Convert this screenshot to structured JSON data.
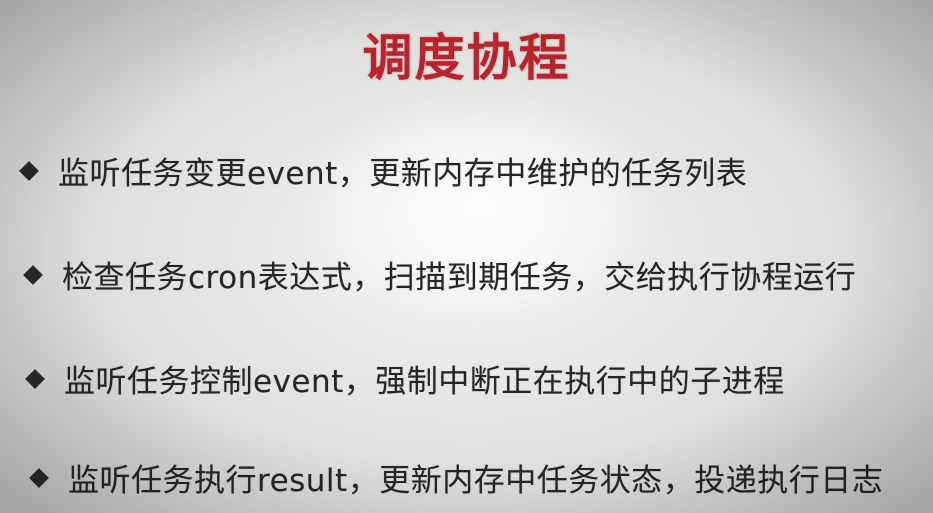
{
  "slide": {
    "title": "调度协程",
    "title_color": "#b8242b",
    "bullets": [
      "监听任务变更event，更新内存中维护的任务列表",
      "检查任务cron表达式，扫描到期任务，交给执行协程运行",
      "监听任务控制event，强制中断正在执行中的子进程",
      "监听任务执行result，更新内存中任务状态，投递执行日志"
    ],
    "bullet_icon": "diamond-bullet-icon"
  }
}
